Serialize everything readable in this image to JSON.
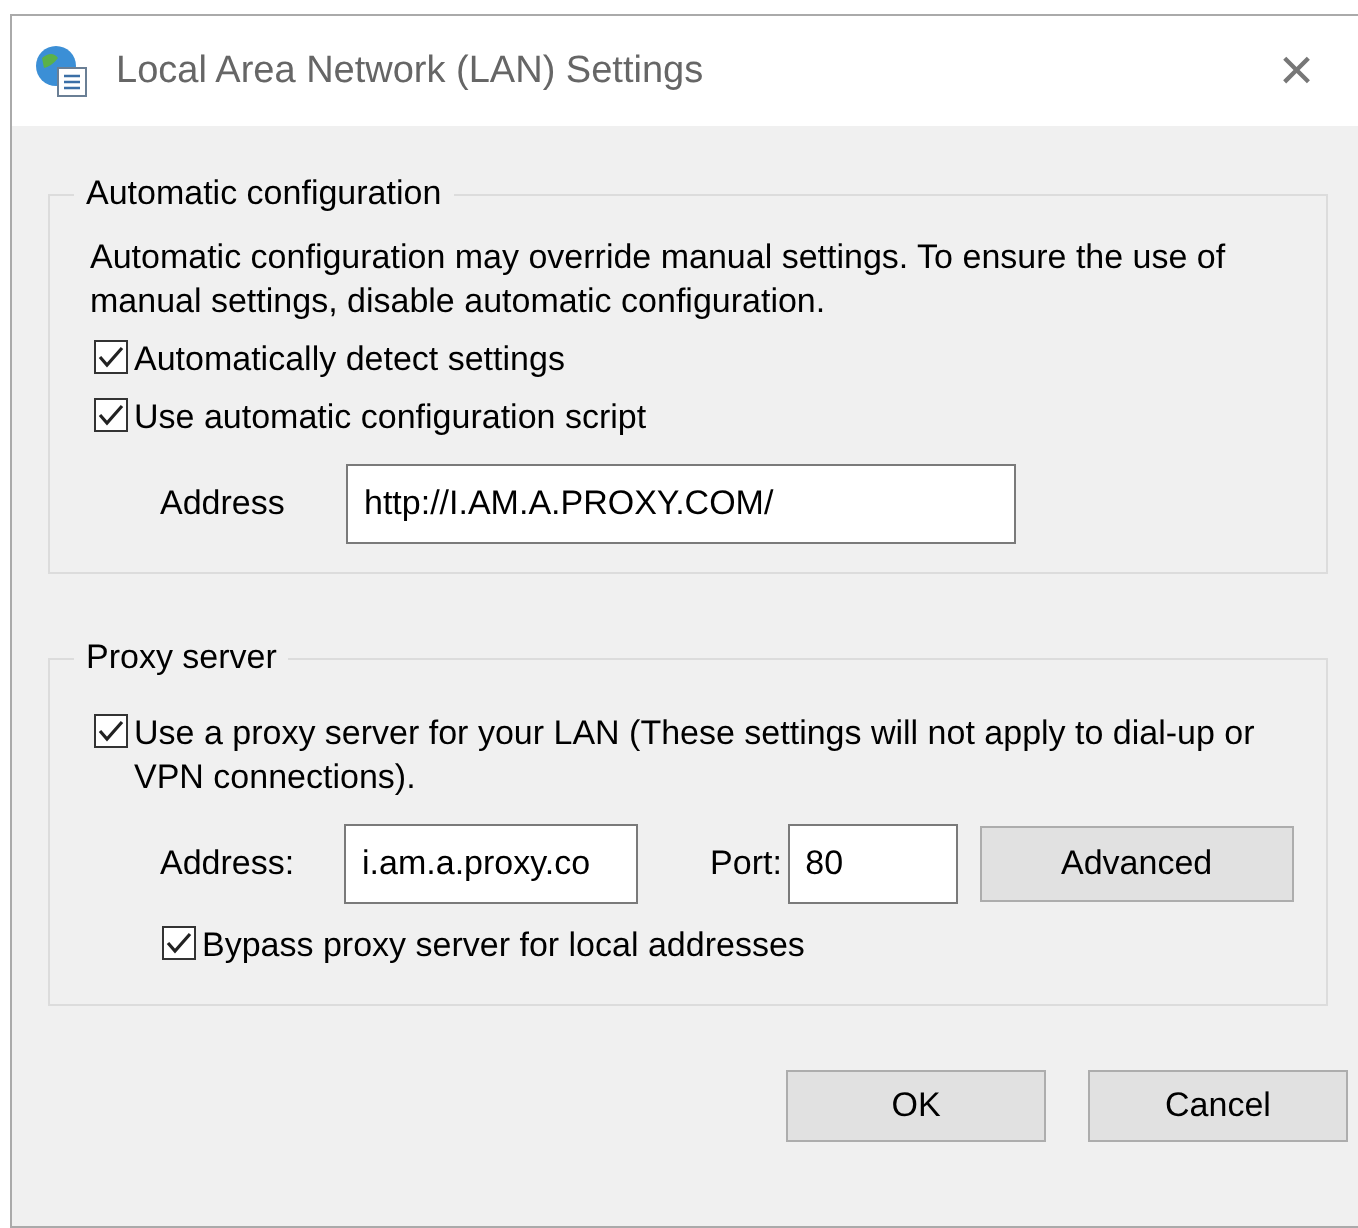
{
  "window": {
    "title": "Local Area Network (LAN) Settings",
    "close": "×"
  },
  "automatic_configuration": {
    "legend": "Automatic configuration",
    "description": "Automatic configuration may override manual settings.  To ensure the use of manual settings, disable automatic configuration.",
    "options": [
      {
        "label": "Automatically detect settings",
        "checked": true
      },
      {
        "label": "Use automatic configuration script",
        "checked": true
      }
    ],
    "address": {
      "label": "Address",
      "value": "http://I.AM.A.PROXY.COM/"
    }
  },
  "proxy_server": {
    "legend": "Proxy server",
    "use_proxy": {
      "label": "Use a proxy server for your LAN (These settings will not apply to dial-up or VPN connections).",
      "checked": true
    },
    "address": {
      "label": "Address:",
      "value": "i.am.a.proxy.co"
    },
    "port": {
      "label": "Port:",
      "value": "80"
    },
    "advanced_button": "Advanced",
    "bypass": {
      "label": "Bypass proxy server for local addresses",
      "checked": true
    }
  },
  "buttons": [
    "OK",
    "Cancel"
  ]
}
